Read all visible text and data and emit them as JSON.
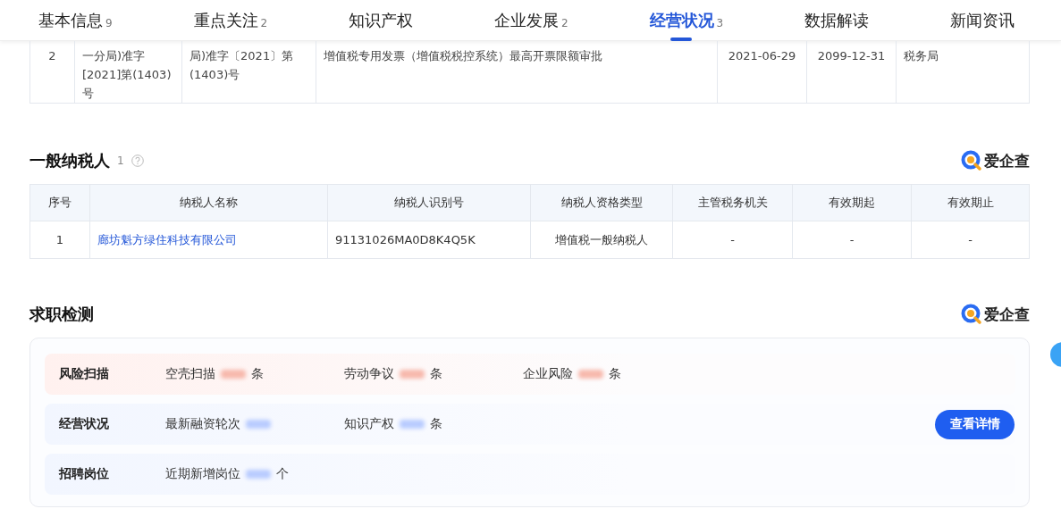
{
  "tabs": [
    {
      "label": "基本信息",
      "count": "9",
      "selected": false
    },
    {
      "label": "重点关注",
      "count": "2",
      "selected": false
    },
    {
      "label": "知识产权",
      "selected": false
    },
    {
      "label": "企业发展",
      "count": "2",
      "selected": false
    },
    {
      "label": "经营状况",
      "count": "3",
      "selected": true
    },
    {
      "label": "数据解读",
      "selected": false
    },
    {
      "label": "新闻资讯",
      "selected": false
    }
  ],
  "license_table": {
    "rows": [
      {
        "cells": [
          "2",
          "一分局)准字[2021]第(1403)号",
          "局)准字〔2021〕第(1403)号",
          "增值税专用发票（增值税税控系统）最高开票限额审批",
          "2021-06-29",
          "2099-12-31",
          "税务局"
        ]
      }
    ]
  },
  "taxpayer": {
    "title": "一般纳税人",
    "count": "1",
    "brand": "爱企查",
    "columns": [
      "序号",
      "纳税人名称",
      "纳税人识别号",
      "纳税人资格类型",
      "主管税务机关",
      "有效期起",
      "有效期止"
    ],
    "rows": [
      {
        "cells": [
          "1",
          "廊坊魁方绿住科技有限公司",
          "91131026MA0D8K4Q5K",
          "增值税一般纳税人",
          "-",
          "-",
          "-"
        ]
      }
    ]
  },
  "job_check": {
    "title": "求职检测",
    "brand": "爱企查",
    "button": "查看详情",
    "rows": [
      {
        "kind": "risk",
        "label": "风险扫描",
        "items": [
          {
            "label": "空壳扫描",
            "unit": "条"
          },
          {
            "label": "劳动争议",
            "unit": "条"
          },
          {
            "label": "企业风险",
            "unit": "条"
          }
        ]
      },
      {
        "kind": "info",
        "label": "经营状况",
        "items": [
          {
            "label": "最新融资轮次"
          },
          {
            "label": "知识产权",
            "unit": "条"
          }
        ]
      },
      {
        "kind": "info",
        "label": "招聘岗位",
        "items": [
          {
            "label": "近期新增岗位",
            "unit": "个"
          }
        ]
      }
    ]
  }
}
